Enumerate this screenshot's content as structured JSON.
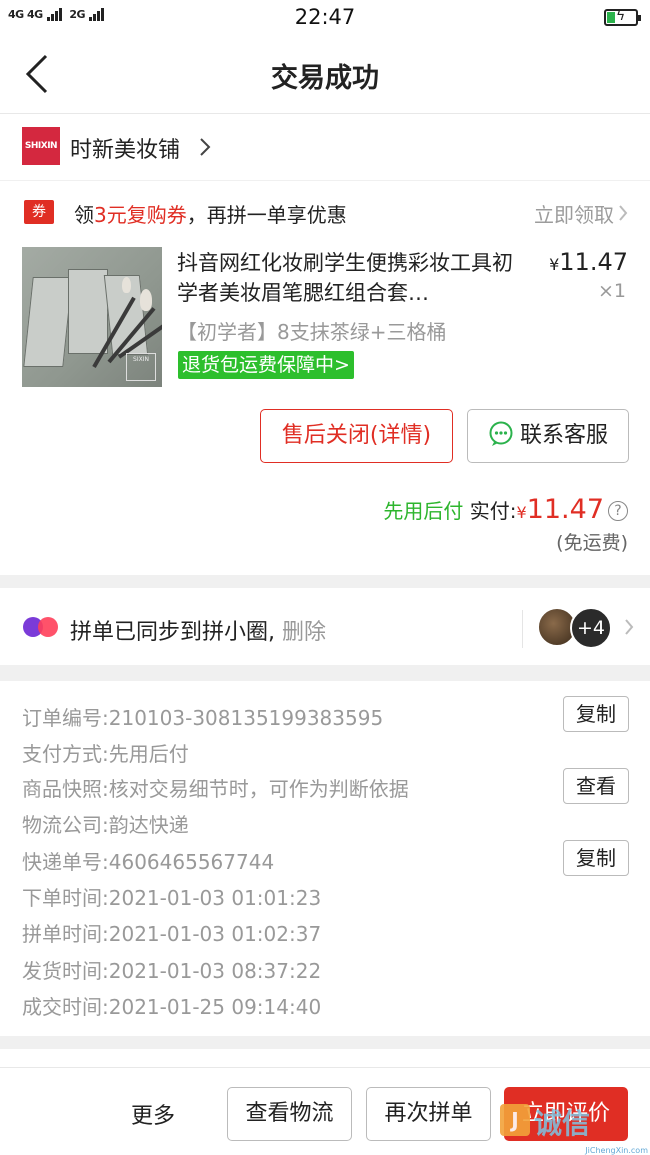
{
  "status_bar": {
    "signal_a": "4G 4G",
    "signal_b": "2G",
    "time": "22:47"
  },
  "nav": {
    "title": "交易成功",
    "back_icon": "chevron-left-icon"
  },
  "shop": {
    "logo_text": "SHIXIN",
    "name": "时新美妆铺",
    "chevron_icon": "chevron-right-icon"
  },
  "coupon": {
    "tag": "券",
    "prefix": "领",
    "highlight": "3元复购券",
    "suffix": "，再拼一单享优惠",
    "link": "立即领取"
  },
  "product": {
    "title": "抖音网红化妆刷学生便携彩妆工具初学者美妆眉笔腮红组合套…",
    "currency": "¥",
    "price": "11.47",
    "qty": "×1",
    "spec": "【初学者】8支抹茶绿+三格桶",
    "badge": "退货包运费保障中>",
    "image_label": "SIXIN"
  },
  "actions": {
    "after_sale": "售后关闭(详情)",
    "customer_service": "联系客服"
  },
  "payment": {
    "method_tag": "先用后付",
    "paid_label": "实付:",
    "currency": "¥",
    "amount": "11.47",
    "help": "?",
    "shipping": "(免运费)"
  },
  "group": {
    "text": "拼单已同步到拼小圈,",
    "delete": "删除",
    "more_count": "+4"
  },
  "order": {
    "rows": [
      {
        "label": "订单编号:",
        "value": "210103-308135199383595"
      },
      {
        "label": "支付方式:",
        "value": "先用后付"
      },
      {
        "label": "商品快照:",
        "value": "核对交易细节时，可作为判断依据"
      },
      {
        "label": "物流公司:",
        "value": "韵达快递"
      },
      {
        "label": "快递单号:",
        "value": "4606465567744"
      },
      {
        "label": "下单时间:",
        "value": "2021-01-03 01:01:23"
      },
      {
        "label": "拼单时间:",
        "value": "2021-01-03 01:02:37"
      },
      {
        "label": "发货时间:",
        "value": "2021-01-03 08:37:22"
      },
      {
        "label": "成交时间:",
        "value": "2021-01-25 09:14:40"
      }
    ],
    "copy_label": "复制",
    "view_label": "查看"
  },
  "bottom": {
    "more": "更多",
    "logistics": "查看物流",
    "again": "再次拼单",
    "review": "立即评价"
  },
  "watermark": {
    "badge": "J",
    "text": "诚信",
    "url": "JiChengXin.com"
  },
  "colors": {
    "accent_red": "#e02e24",
    "green": "#2dbf2d",
    "muted": "#999999"
  }
}
